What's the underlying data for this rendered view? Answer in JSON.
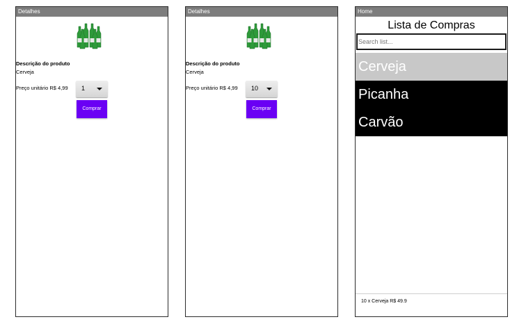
{
  "screens": [
    {
      "title": "Detalhes",
      "description_label": "Descrição do produto",
      "product_name": "Cerveja",
      "price_label": "Preço unitário R$ 4,99",
      "quantity": "1",
      "buy_label": "Comprar"
    },
    {
      "title": "Detalhes",
      "description_label": "Descrição do produto",
      "product_name": "Cerveja",
      "price_label": "Preço unitário R$ 4,99",
      "quantity": "10",
      "buy_label": "Comprar"
    }
  ],
  "home": {
    "title": "Home",
    "heading": "Lista de Compras",
    "search_placeholder": "Search list...",
    "items": [
      "Cerveja",
      "Picanha",
      "Carvão"
    ],
    "selected_item": "Cerveja",
    "footer": "10 x Cerveja R$ 49.9"
  },
  "colors": {
    "titlebar": "#7d7d7d",
    "buy_button": "#6a00f4",
    "list_item_bg": "#000000",
    "selected_item_bg": "#c8c8c8",
    "bottle_green": "#2e9a3a"
  },
  "icons": {
    "product_image": "beer-bottles-icon",
    "spinner_arrow": "caret-down-icon"
  }
}
